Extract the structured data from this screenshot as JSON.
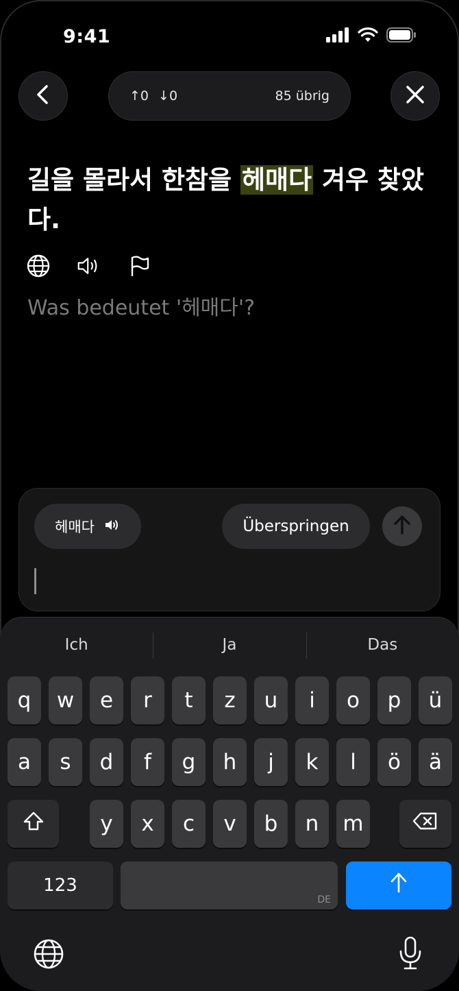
{
  "status": {
    "time": "9:41"
  },
  "top": {
    "up_count": "0",
    "down_count": "0",
    "remaining": "85 übrig"
  },
  "sentence": {
    "before": "길을 몰라서 한참을 ",
    "highlight": "헤매다",
    "after": " 겨우 찾았다."
  },
  "question": "Was bedeutet '헤매다'?",
  "answer": {
    "word_chip": "헤매다",
    "skip_label": "Überspringen",
    "input_value": ""
  },
  "keyboard": {
    "suggestions": [
      "Ich",
      "Ja",
      "Das"
    ],
    "row1": [
      "q",
      "w",
      "e",
      "r",
      "t",
      "z",
      "u",
      "i",
      "o",
      "p",
      "ü"
    ],
    "row2": [
      "a",
      "s",
      "d",
      "f",
      "g",
      "h",
      "j",
      "k",
      "l",
      "ö",
      "ä"
    ],
    "row3": [
      "y",
      "x",
      "c",
      "v",
      "b",
      "n",
      "m"
    ],
    "numbers_label": "123",
    "space_lang": "DE"
  },
  "colors": {
    "highlight": "#3a4212",
    "send_key": "#0a84ff",
    "question_text": "#7a7a7a"
  }
}
